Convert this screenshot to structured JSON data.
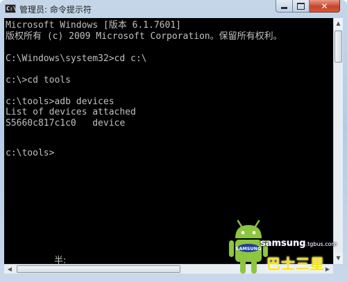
{
  "window": {
    "icon_text": "C:\\",
    "title": "管理员: 命令提示符",
    "close_symbol": "✕"
  },
  "console": {
    "lines": [
      "Microsoft Windows [版本 6.1.7601]",
      "版权所有 (c) 2009 Microsoft Corporation。保留所有权利。",
      "C:\\Windows\\system32>cd c:\\",
      "c:\\>cd tools",
      "c:\\tools>adb devices",
      "List of devices attached",
      "S5660c817c1c0   device",
      "c:\\tools>"
    ],
    "ime_status": "半:"
  },
  "watermark": {
    "brand": "SAMSUNG",
    "site": "samsung",
    "site_suffix": ".tgbus.com",
    "name": "巴士三星"
  },
  "colors": {
    "console_bg": "#000000",
    "console_text": "#c0c0c0",
    "title_bar": "#c5d6e9",
    "close_button": "#c8442b",
    "android_green": "#8dc63f",
    "watermark_yellow": "#f4e600"
  },
  "icons": [
    "cmd-app-icon",
    "minimize-icon",
    "maximize-icon",
    "close-icon",
    "scroll-up-icon",
    "scroll-down-icon",
    "scroll-left-icon",
    "scroll-right-icon",
    "android-robot-icon"
  ]
}
